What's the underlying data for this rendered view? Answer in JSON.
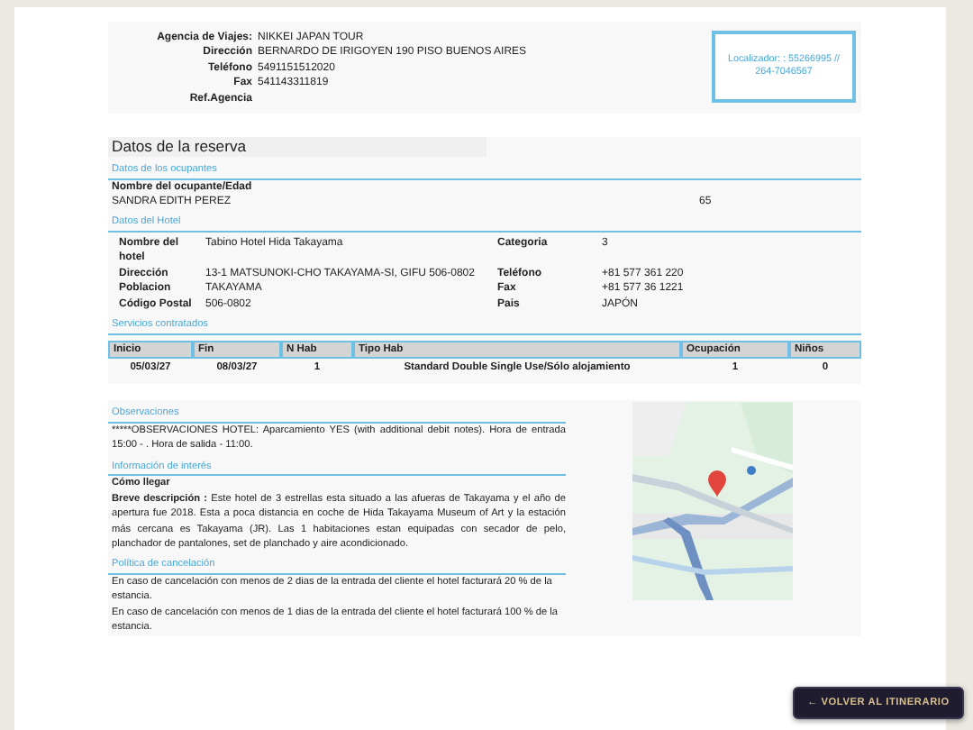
{
  "agency": {
    "rows": [
      {
        "label": "Agencia de Viajes:",
        "value": "NIKKEI JAPAN TOUR"
      },
      {
        "label": "Dirección",
        "value": "BERNARDO DE IRIGOYEN 190 PISO BUENOS AIRES"
      },
      {
        "label": "Teléfono",
        "value": "5491151512020"
      },
      {
        "label": "Fax",
        "value": "541143311819"
      },
      {
        "label": "Ref.Agencia"
      }
    ],
    "locator": "Localizador: : 55266995 // 264-7046567"
  },
  "reservation_title": "Datos de la reserva",
  "occupants": {
    "heading": "Datos de los ocupantes",
    "column": "Nombre del ocupante/Edad",
    "name": "SANDRA EDITH PEREZ",
    "age": "65"
  },
  "hotel": {
    "heading": "Datos del Hotel",
    "fields": [
      {
        "label": "Nombre del hotel",
        "value": "Tabino Hotel Hida Takayama"
      },
      {
        "label": "Categoria",
        "value": "3"
      },
      {
        "label": "Dirección",
        "value": "13-1 MATSUNOKI-CHO TAKAYAMA-SI, GIFU 506-0802"
      },
      {
        "label": "Teléfono",
        "value": "+81 577 361 220"
      },
      {
        "label": "Poblacion",
        "value": "TAKAYAMA"
      },
      {
        "label": "Fax",
        "value": "+81 577 36 1221"
      },
      {
        "label": "Código Postal",
        "value": "506-0802"
      },
      {
        "label": "Pais",
        "value": "JAPÓN"
      }
    ]
  },
  "services": {
    "heading": "Servicios contratados",
    "columns": [
      "Inicio",
      "Fin",
      "N Hab",
      "Tipo Hab",
      "Ocupación",
      "Niños"
    ],
    "rows": [
      [
        "05/03/27",
        "08/03/27",
        "1",
        "Standard Double Single Use/Sólo alojamiento",
        "1",
        "0"
      ]
    ]
  },
  "observations": {
    "heading": "Observaciones",
    "text": "*****OBSERVACIONES HOTEL: Aparcamiento YES (with additional debit notes). Hora de entrada 15:00 - . Hora de salida - 11:00."
  },
  "info": {
    "heading": "Información de interés",
    "subheading": "Cómo llegar",
    "text": "**Breve descripción :** Este hotel de 3 estrellas esta situado a las afueras de Takayama y el año de apertura fue 2018. Esta a poca distancia en coche de Hida Takayama Museum of Art y la estación más cercana es Takayama (JR). Las 1 habitaciones estan equipadas con secador de pelo, planchador de pantalones, set de planchado y aire acondicionado."
  },
  "cancellation": {
    "heading": "Política de cancelación",
    "items": [
      "En caso de cancelación con menos de 2 dias de la entrada del cliente el hotel facturará 20 % de la estancia.",
      "En caso de cancelación con menos de 1 dias de la entrada del cliente el hotel facturará 100 % de la estancia."
    ]
  },
  "back_button": "← VOLVER AL ITINERARIO"
}
